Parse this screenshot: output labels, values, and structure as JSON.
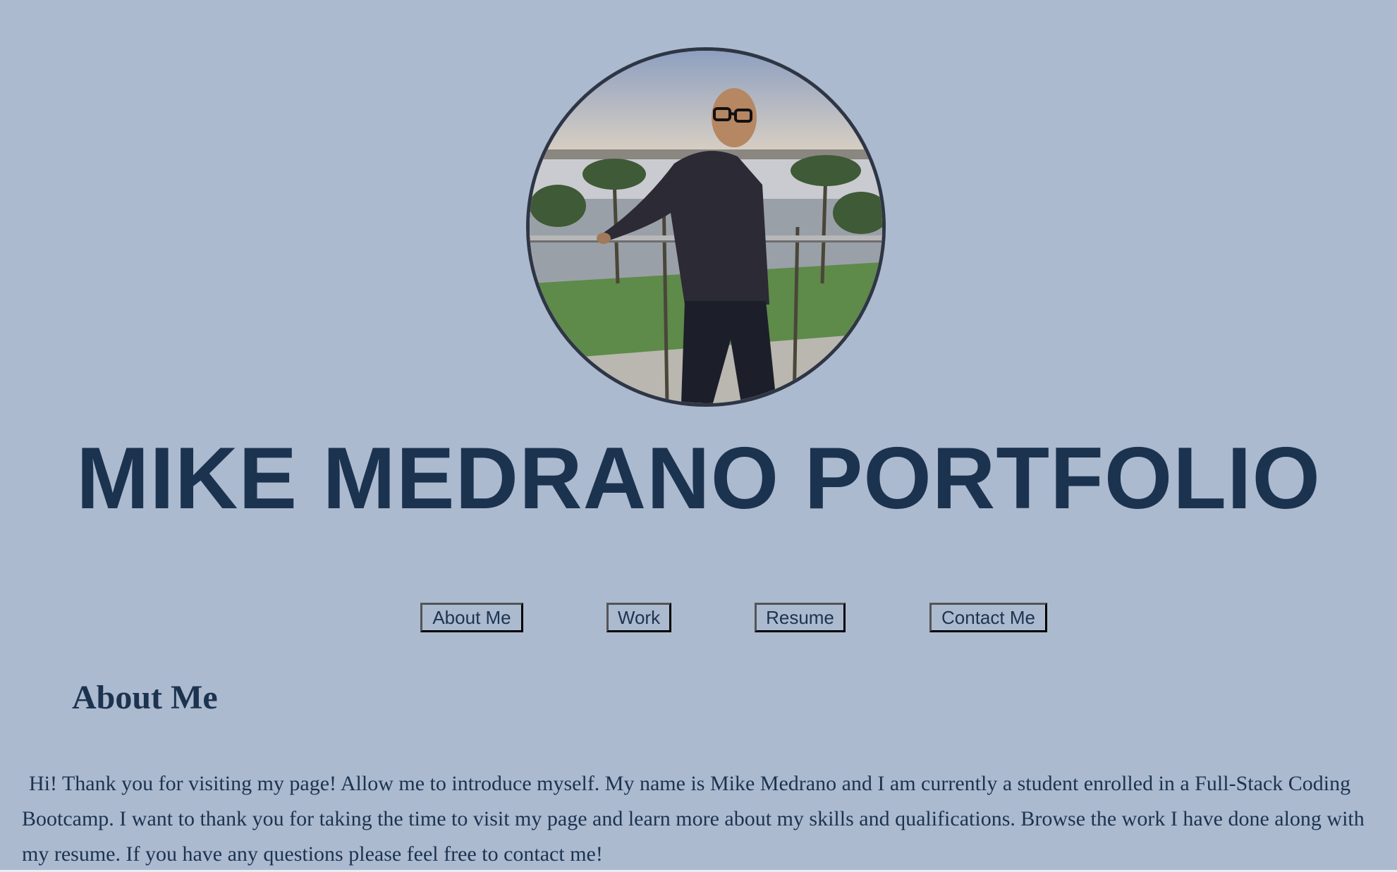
{
  "header": {
    "title": "MIKE MEDRANO PORTFOLIO"
  },
  "nav": {
    "about": "About Me",
    "work": "Work",
    "resume": "Resume",
    "contact": "Contact Me"
  },
  "about": {
    "heading": "About Me",
    "text": "Hi! Thank you for visiting my page! Allow me to introduce myself. My name is Mike Medrano and I am currently a student enrolled in a Full-Stack Coding Bootcamp. I want to thank you for taking the time to visit my page and learn more about my skills and qualifications. Browse the work I have done along with my resume. If you have any questions please feel free to contact me!"
  },
  "colors": {
    "background": "#abbacf",
    "text": "#1c3350",
    "photo_border": "#2e3645"
  }
}
